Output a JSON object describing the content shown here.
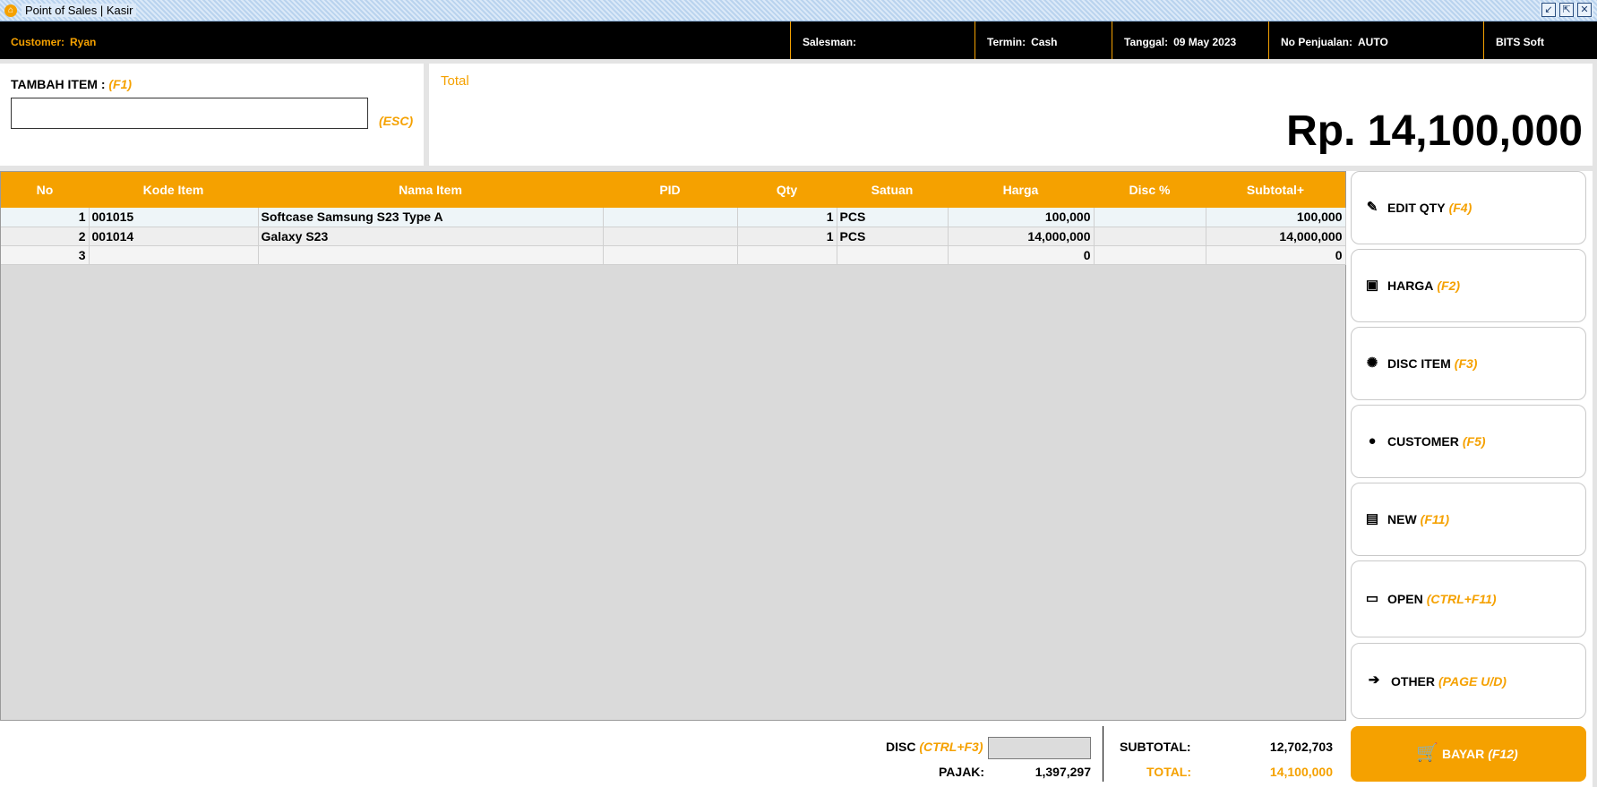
{
  "window": {
    "title": "Point of Sales | Kasir"
  },
  "info_bar": {
    "customer_label": "Customer:",
    "customer_value": "Ryan",
    "salesman_label": "Salesman:",
    "salesman_value": "",
    "termin_label": "Termin:",
    "termin_value": "Cash",
    "tanggal_label": "Tanggal:",
    "tanggal_value": "09 May 2023",
    "no_penjualan_label": "No Penjualan:",
    "no_penjualan_value": "AUTO",
    "brand": "BITS Soft"
  },
  "add_item": {
    "label": "TAMBAH ITEM :",
    "shortcut": "(F1)",
    "value": "",
    "esc_shortcut": "(ESC)"
  },
  "total_panel": {
    "label": "Total",
    "amount": "Rp. 14,100,000"
  },
  "table": {
    "headers": [
      "No",
      "Kode Item",
      "Nama Item",
      "PID",
      "Qty",
      "Satuan",
      "Harga",
      "Disc %",
      "Subtotal+"
    ],
    "rows": [
      {
        "no": "1",
        "kode": "001015",
        "nama": "Softcase Samsung S23 Type A",
        "pid": "",
        "qty": "1",
        "satuan": "PCS",
        "harga": "100,000",
        "disc": "",
        "subtotal": "100,000"
      },
      {
        "no": "2",
        "kode": "001014",
        "nama": "Galaxy S23",
        "pid": "",
        "qty": "1",
        "satuan": "PCS",
        "harga": "14,000,000",
        "disc": "",
        "subtotal": "14,000,000"
      },
      {
        "no": "3",
        "kode": "",
        "nama": "",
        "pid": "",
        "qty": "",
        "satuan": "",
        "harga": "0",
        "disc": "",
        "subtotal": "0"
      }
    ]
  },
  "side_buttons": [
    {
      "label": "EDIT QTY",
      "shortcut": "(F4)",
      "icon": "edit-icon"
    },
    {
      "label": "HARGA",
      "shortcut": "(F2)",
      "icon": "money-icon"
    },
    {
      "label": "DISC ITEM",
      "shortcut": "(F3)",
      "icon": "discount-icon"
    },
    {
      "label": "CUSTOMER",
      "shortcut": "(F5)",
      "icon": "person-icon"
    },
    {
      "label": "NEW",
      "shortcut": "(F11)",
      "icon": "document-icon"
    },
    {
      "label": "OPEN",
      "shortcut": "(CTRL+F11)",
      "icon": "folder-icon"
    },
    {
      "label": "OTHER",
      "shortcut": "(PAGE U/D)",
      "icon": "arrow-right-icon"
    }
  ],
  "footer": {
    "disc_label": "DISC",
    "disc_shortcut": "(CTRL+F3)",
    "disc_value": "",
    "pajak_label": "PAJAK:",
    "pajak_value": "1,397,297",
    "subtotal_label": "SUBTOTAL:",
    "subtotal_value": "12,702,703",
    "total_label": "TOTAL:",
    "total_value": "14,100,000"
  },
  "bayar_button": {
    "label": "BAYAR",
    "shortcut": "(F12)",
    "icon": "cart-icon"
  },
  "colors": {
    "accent": "#f5a100",
    "header_bg": "#000000",
    "grid_bg": "#dadada"
  }
}
